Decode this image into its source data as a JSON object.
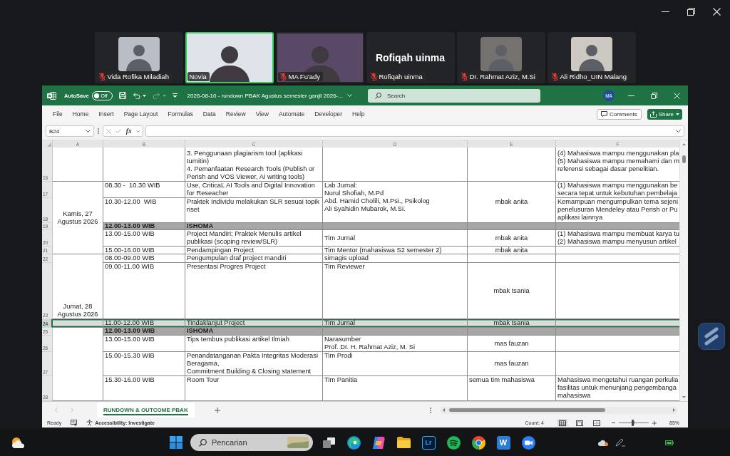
{
  "meeting": {
    "participants": [
      {
        "name": "Vida Rofika Miladiah",
        "kind": "photo",
        "muted": true,
        "speaking": false
      },
      {
        "name": "Novia",
        "kind": "video",
        "muted": false,
        "speaking": true
      },
      {
        "name": "MA Fu'ady",
        "kind": "video",
        "muted": true,
        "speaking": false
      },
      {
        "name": "Rofiqah uinma",
        "display_name": "Rofiqah uinma",
        "kind": "name",
        "muted": true,
        "speaking": false
      },
      {
        "name": "Dr. Rahmat Aziz, M.Si",
        "kind": "photo",
        "muted": true,
        "speaking": false
      },
      {
        "name": "Ali Ridho_UIN Malang",
        "kind": "photo",
        "muted": true,
        "speaking": false
      }
    ]
  },
  "excel": {
    "quick_access": {
      "autosave_label": "AutoSave",
      "autosave": {
        "on": false,
        "label": "Off"
      },
      "tools": [
        {
          "kind": "save",
          "disabled": false
        },
        {
          "kind": "undo",
          "disabled": false
        },
        {
          "kind": "redo",
          "disabled": true
        },
        {
          "kind": "customize",
          "disabled": false
        }
      ]
    },
    "title": "2026-08-10 - rundown PBAK Agustus semester ganjil 2026-...",
    "search": {
      "placeholder": "Search"
    },
    "account": "MA",
    "menu": [
      "File",
      "Home",
      "Insert",
      "Page Layout",
      "Formulas",
      "Data",
      "Review",
      "View",
      "Automate",
      "Developer",
      "Help"
    ],
    "comments": "Comments",
    "share": "Share",
    "formula_bar": {
      "name_box": "B24",
      "function_label": "fx"
    },
    "sheet": {
      "columns": [
        "A",
        "B",
        "C",
        "D",
        "E",
        "F"
      ],
      "rows": [
        {
          "number": "16",
          "kind": "session",
          "selected": false,
          "cells": {
            "C": "3. Penggunaan plagiarism tool (aplikasi\nturnitin)\n4. Pemanfaatan Research Tools (Publish or\nPerish and VOS Viewer, AI writing tools)",
            "F": "(4) Mahasiswa mampu menggunakan pla\n(5) Mahasiswa mampu memahami dan m\nreferensi sebagai dasar penelitian."
          }
        },
        {
          "number": "17",
          "kind": "session",
          "selected": false,
          "cells": {
            "A": "Kamis, 27\nAgustus 2026",
            "B": "08.30 -  10.30 WIB",
            "C": "Use, CriticaL AI Tools and Digital Innovation\nfor Reseacher",
            "D": "Lab Jurnal:\nNurul Shofiah, M.Pd\nAbd. Hamid Cholili, M.Psi., Psikolog\nAli Syahidin Mubarok, M.Si.",
            "E": "mbak anita",
            "F": "(1) Mahasiswa mampu menggunakan be\nsecara tepat untuk kebutuhan pembelaja"
          }
        },
        {
          "number": "18",
          "kind": "session",
          "selected": false,
          "cells": {
            "B": "10.30-12.00  WIB",
            "C": "Praktek Individu melakukan SLR sesuai topik\nriset",
            "F": "Kemampuan mengumpulkan tema sejeni\npenelusuran Mendeley atau Perish or Pu\naplikasi lainnya"
          }
        },
        {
          "number": "19",
          "kind": "break",
          "selected": false,
          "cells": {
            "B": "12.00-13.00 WIB",
            "C": "ISHOMA"
          }
        },
        {
          "number": "20",
          "kind": "session",
          "selected": false,
          "cells": {
            "B": "13.00-15.00 WIB",
            "C": "Project Mandiri; Praktek Menulis artikel\npublikasi (scoping review/SLR)",
            "D": "Tim Jurnal",
            "E": "mbak anita",
            "F": "(1) Mahasiswa mampu membuat karya tu\n(2) Mahasiswa mampu menyusun artikel"
          }
        },
        {
          "number": "21",
          "kind": "session",
          "selected": false,
          "cells": {
            "B": "15.00-16.00 WIB",
            "C": "Pendampingan Project",
            "D": "Tim Mentor (mahasiswa S2 semester 2)",
            "E": "mbak anita"
          }
        },
        {
          "number": "22",
          "kind": "session",
          "selected": false,
          "cells": {
            "A": "Jumat, 28\nAgustus 2026",
            "B": "08.00-09.00 WIB",
            "C": "Pengumpulan draf project mandiri",
            "D": "simagis upload"
          }
        },
        {
          "number": "23",
          "kind": "session",
          "selected": false,
          "cells": {
            "B": "09.00-11.00 WIB",
            "C": "Presentasi Progres Project",
            "D": "Tim Reviewer",
            "E": "mbak tsania"
          }
        },
        {
          "number": "24",
          "kind": "session",
          "selected": true,
          "cells": {
            "B": "11.00-12.00 WIB",
            "C": "Tindaklanjut Project",
            "D": "Tim Jurnal",
            "E": "mbak tsania"
          }
        },
        {
          "number": "25",
          "kind": "break",
          "selected": false,
          "cells": {
            "B": "12.00-13.00 WIB",
            "C": "ISHOMA"
          }
        },
        {
          "number": "26",
          "kind": "session",
          "selected": false,
          "cells": {
            "B": "13.00-15.00 WIB",
            "C": "Tips tembus publikasi artikel Ilmiah",
            "D": "Narasumber\nProf. Dr. H. Rahmat Aziz, M. Si",
            "E": "mas fauzan"
          }
        },
        {
          "number": "27",
          "kind": "session",
          "selected": false,
          "cells": {
            "B": "15.00-15.30 WIB",
            "C": "Penandatanganan Pakta Integritas Moderasi\nBeragama,\nCommitment Building & Closing statement",
            "D": "Tim Prodi",
            "E": "mas fauzan"
          }
        },
        {
          "number": "28",
          "kind": "session",
          "selected": false,
          "cells": {
            "B": "15.30-16.00 WIB",
            "C": "Room Tour",
            "D": "Tim Panitia",
            "E": "semua tim mahasiswa",
            "F": "Mahasiswa mengetahui ruangan perkulia\nfasilitas untuk menunjang pengembanga\nmahasiswa"
          }
        }
      ]
    },
    "sheet_tabs": [
      {
        "label": "RUNDOWN & OUTCOME PBAK",
        "selected": true
      }
    ],
    "status_bar": {
      "mode": "Ready",
      "accessibility": "Accessibility: Investigate",
      "count": "Count: 4",
      "views": [
        {
          "kind": "normal",
          "selected": true
        },
        {
          "kind": "page-layout",
          "selected": false
        },
        {
          "kind": "page-break",
          "selected": false
        }
      ],
      "zoom": {
        "level": 0.46,
        "label": "85%"
      }
    }
  },
  "taskbar": {
    "search": {
      "placeholder": "Pencarian"
    },
    "apps": [
      {
        "kind": "task-view"
      },
      {
        "kind": "edge"
      },
      {
        "kind": "copilot"
      },
      {
        "kind": "explorer"
      },
      {
        "kind": "lightroom",
        "label": "Lr"
      },
      {
        "kind": "spotify"
      },
      {
        "kind": "chrome"
      },
      {
        "kind": "word",
        "label": "W"
      },
      {
        "kind": "zoom"
      }
    ]
  }
}
